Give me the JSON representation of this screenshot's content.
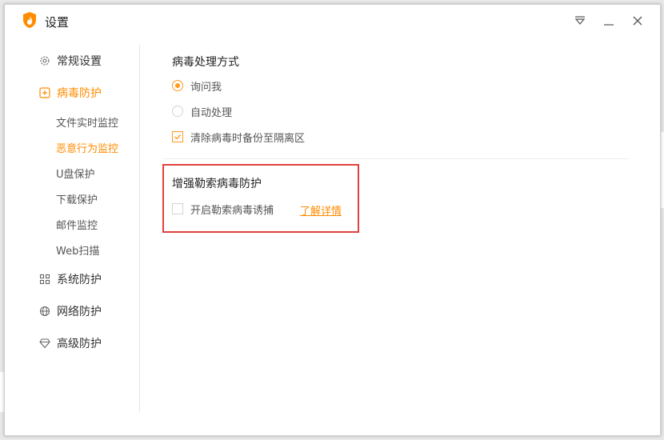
{
  "window": {
    "title": "设置",
    "controls": [
      "dropdown-icon",
      "minimize-icon",
      "close-icon"
    ],
    "accent_color": "#ff8c00",
    "highlight_color": "#e0413d"
  },
  "sidebar": {
    "items": [
      {
        "label": "常规设置",
        "icon": "gear-icon",
        "active": false
      },
      {
        "label": "病毒防护",
        "icon": "plus-square-icon",
        "active": true
      },
      {
        "label": "系统防护",
        "icon": "grid-icon",
        "active": false
      },
      {
        "label": "网络防护",
        "icon": "globe-icon",
        "active": false
      },
      {
        "label": "高级防护",
        "icon": "diamond-icon",
        "active": false
      }
    ],
    "subitems": [
      {
        "label": "文件实时监控",
        "active": false
      },
      {
        "label": "恶意行为监控",
        "active": true
      },
      {
        "label": "U盘保护",
        "active": false
      },
      {
        "label": "下载保护",
        "active": false
      },
      {
        "label": "邮件监控",
        "active": false
      },
      {
        "label": "Web扫描",
        "active": false
      }
    ]
  },
  "main": {
    "virus_handling": {
      "title": "病毒处理方式",
      "options": [
        {
          "label": "询问我",
          "selected": true
        },
        {
          "label": "自动处理",
          "selected": false
        }
      ],
      "backup_checkbox": {
        "label": "清除病毒时备份至隔离区",
        "checked": true
      }
    },
    "ransomware": {
      "title": "增强勒索病毒防护",
      "checkbox": {
        "label": "开启勒索病毒诱捕",
        "checked": false
      },
      "link": "了解详情"
    }
  }
}
